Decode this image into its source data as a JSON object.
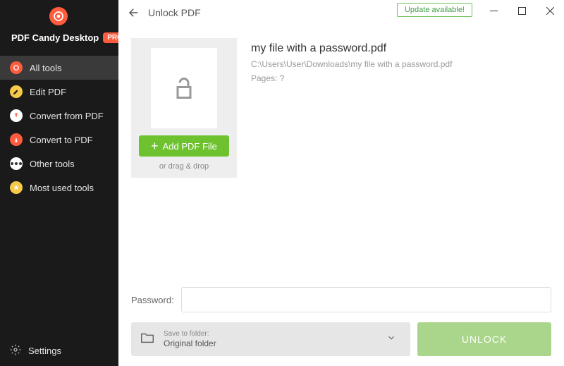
{
  "brand": {
    "title": "PDF Candy Desktop",
    "badge": "PRO"
  },
  "sidebar": {
    "items": [
      {
        "label": "All tools"
      },
      {
        "label": "Edit PDF"
      },
      {
        "label": "Convert from PDF"
      },
      {
        "label": "Convert to PDF"
      },
      {
        "label": "Other tools"
      },
      {
        "label": "Most used tools"
      }
    ],
    "settings": "Settings"
  },
  "titlebar": {
    "page_title": "Unlock PDF",
    "update_label": "Update available!"
  },
  "dropzone": {
    "add_label": "Add PDF File",
    "drag_hint": "or drag & drop"
  },
  "file": {
    "name": "my file with a password.pdf",
    "path": "C:\\Users\\User\\Downloads\\my file with a password.pdf",
    "pages": "Pages: ?"
  },
  "password": {
    "label": "Password:",
    "value": ""
  },
  "folder": {
    "label": "Save to folder:",
    "value": "Original folder"
  },
  "actions": {
    "unlock": "UNLOCK"
  }
}
